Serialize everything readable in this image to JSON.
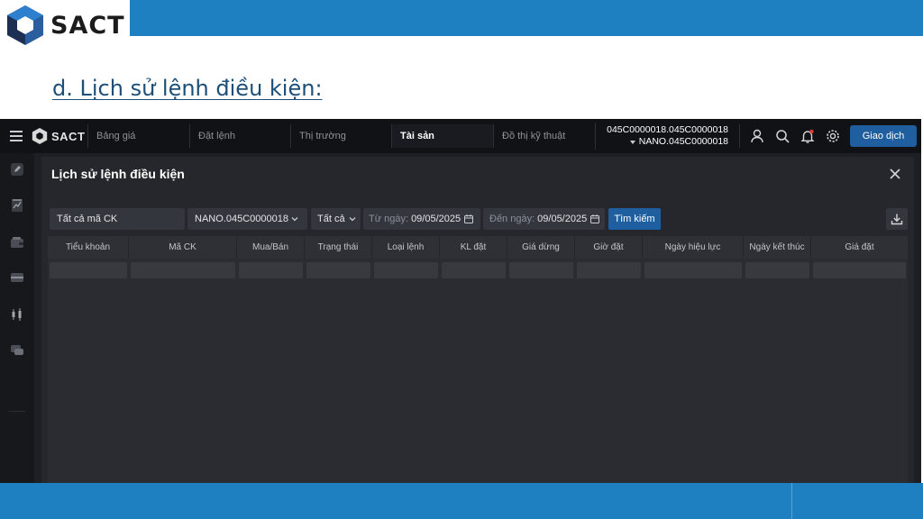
{
  "slide": {
    "logo_text": "SACT",
    "heading": "d. Lịch sử lệnh điều kiện:"
  },
  "nav": {
    "logo_text": "SACT",
    "items": [
      {
        "label": "Bảng giá",
        "active": false
      },
      {
        "label": "Đặt lệnh",
        "active": false
      },
      {
        "label": "Thị trường",
        "active": false
      },
      {
        "label": "Tài sản",
        "active": true
      },
      {
        "label": "Đồ thị kỹ thuật",
        "active": false
      }
    ],
    "account_line1": "045C0000018.045C0000018",
    "account_line2": "NANO.045C0000018",
    "icons": [
      "user-icon",
      "search-icon",
      "bell-icon",
      "gear-icon"
    ],
    "trade_button": "Giao dịch"
  },
  "sidebar": {
    "icons": [
      "edit-icon",
      "chart-doc-icon",
      "wallet-icon",
      "card-icon",
      "candlestick-icon",
      "chat-icon"
    ]
  },
  "panel": {
    "title": "Lịch sử lệnh điều kiện",
    "filters": {
      "symbol_value": "Tất cả mã CK",
      "account_value": "NANO.045C0000018",
      "side_value": "Tất cả",
      "from_label": "Từ ngày:",
      "from_value": "09/05/2025",
      "to_label": "Đến ngày:",
      "to_value": "09/05/2025",
      "search_button": "Tìm kiếm"
    },
    "table": {
      "columns": [
        "Tiểu khoản",
        "Mã CK",
        "Mua/Bán",
        "Trạng thái",
        "Loại lệnh",
        "KL đặt",
        "Giá dừng",
        "Giờ đặt",
        "Ngày hiệu lực",
        "Ngày kết thúc",
        "Giá đặt"
      ],
      "rows": []
    }
  },
  "colors": {
    "brand_blue": "#1e7fc1",
    "button_blue": "#1f5f9f",
    "nav_bg": "#111216",
    "panel_bg": "#26272c"
  }
}
